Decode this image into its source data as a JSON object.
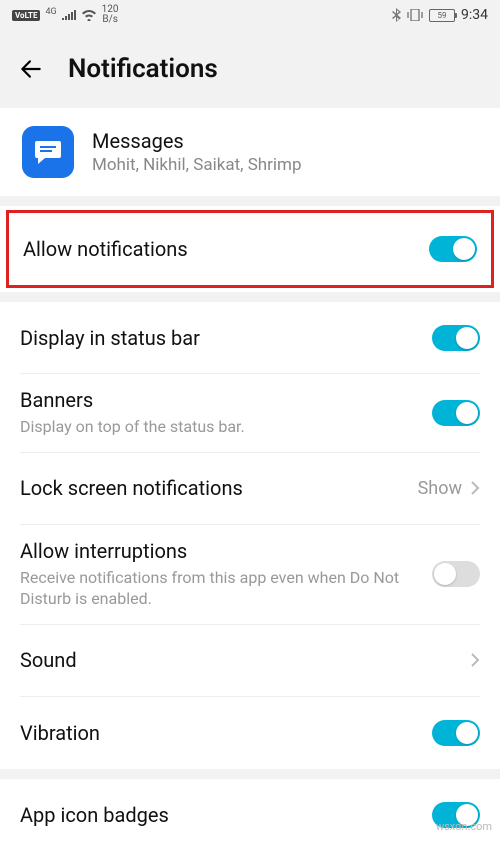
{
  "status": {
    "volte": "VoLTE",
    "net_gen": "4G",
    "speed_top": "120",
    "speed_bot": "B/s",
    "battery": "59",
    "time": "9:34"
  },
  "header": {
    "title": "Notifications"
  },
  "app": {
    "name": "Messages",
    "subtitle": "Mohit, Nikhil, Saikat, Shrimp"
  },
  "rows": {
    "allow": {
      "title": "Allow notifications"
    },
    "display_status": {
      "title": "Display in status bar"
    },
    "banners": {
      "title": "Banners",
      "sub": "Display on top of the status bar."
    },
    "lockscreen": {
      "title": "Lock screen notifications",
      "value": "Show"
    },
    "interruptions": {
      "title": "Allow interruptions",
      "sub": "Receive notifications from this app even when Do Not Disturb is enabled."
    },
    "sound": {
      "title": "Sound"
    },
    "vibration": {
      "title": "Vibration"
    },
    "badges": {
      "title": "App icon badges"
    }
  },
  "watermark": "wsxdn.com"
}
